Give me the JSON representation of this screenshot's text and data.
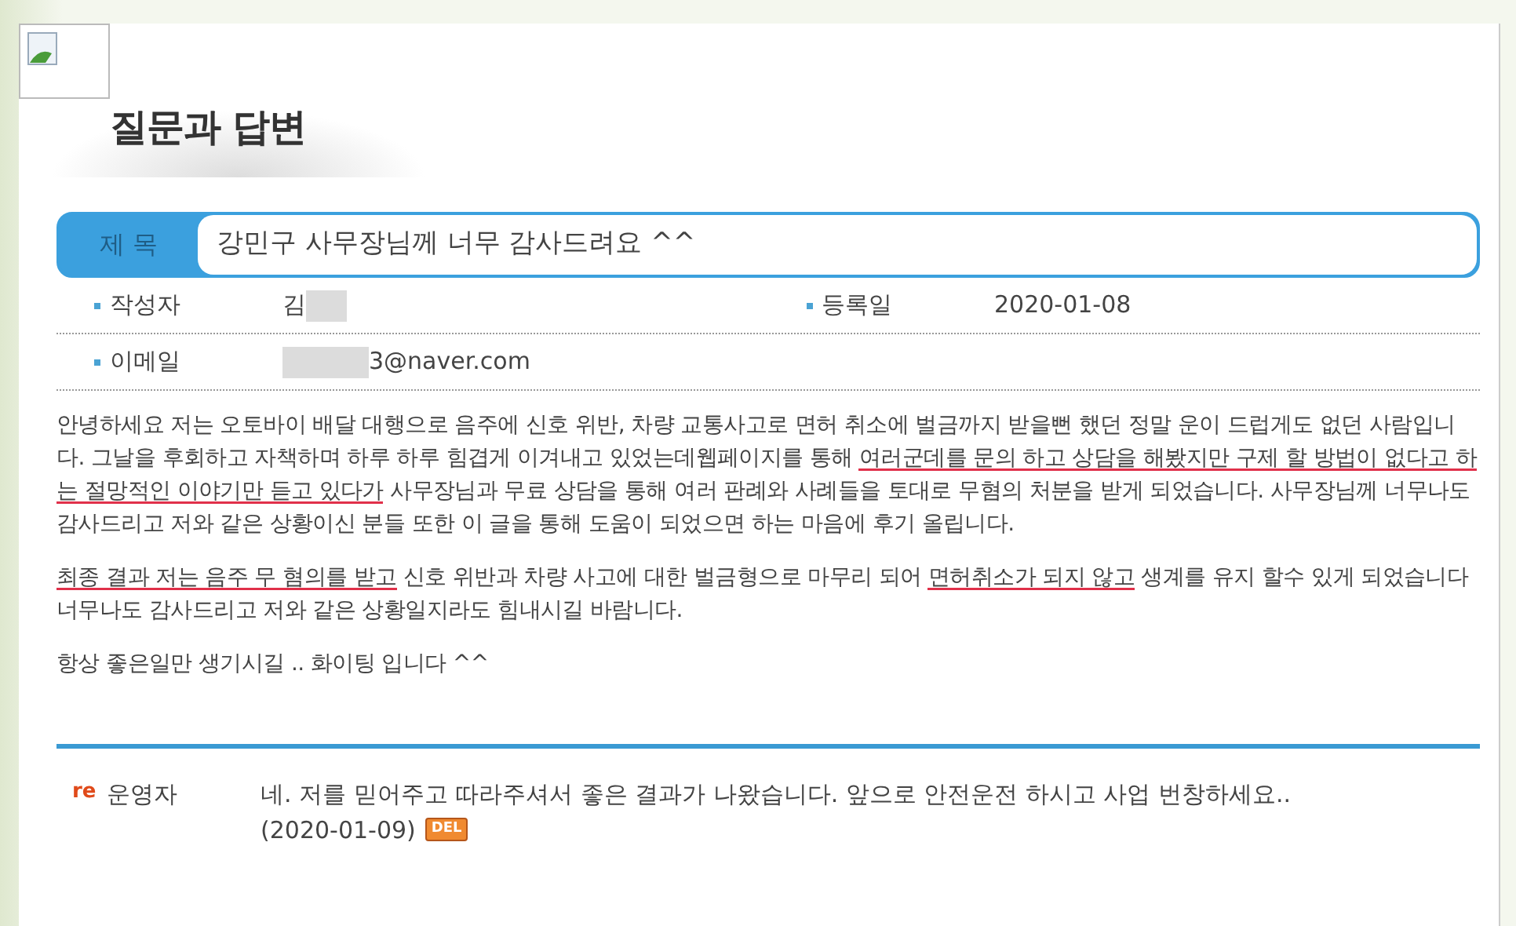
{
  "page_title": "질문과 답변",
  "subject": {
    "label": "제 목",
    "value": "강민구 사무장님께 너무 감사드려요 ^^"
  },
  "meta": [
    {
      "label": "작성자",
      "value": "김",
      "redacted": true
    },
    {
      "label": "등록일",
      "value": "2020-01-08"
    },
    {
      "label": "이메일",
      "value": "3@naver.com",
      "redacted": true
    }
  ],
  "body": [
    {
      "segments": [
        {
          "text": "안녕하세요 저는 오토바이  배달 대행으로 음주에 신호 위반, 차량 교통사고로 면허 취소에 벌금까지 받을뻔 했던 정말 운이 드럽게도 없던 사람입니다. 그날을 후회하고 자책하며 하루 하루 힘겹게 이겨내고 있었는데웹페이지를 통해 ",
          "underlined": false
        },
        {
          "text": "여러군데를 문의 하고 상담을 해봤지만 구제 할 방법이 없다고 하는 절망적인 이야기만 듣고 있다가",
          "underlined": true
        },
        {
          "text": " 사무장님과 무료 상담을 통해 여러 판례와 사례들을 토대로 무혐의 처분을 받게 되었습니다. 사무장님께 너무나도 감사드리고 저와 같은 상황이신 분들 또한 이 글을 통해 도움이 되었으면 하는 마음에 후기 올립니다.",
          "underlined": false
        }
      ]
    },
    {
      "segments": [
        {
          "text": "최종 결과 저는 음주 무 혐의를 받고",
          "underlined": true
        },
        {
          "text": " 신호 위반과 차량 사고에 대한 벌금형으로 마무리 되어 ",
          "underlined": false
        },
        {
          "text": "면허취소가 되지 않고",
          "underlined": true
        },
        {
          "text": " 생계를 유지  할수 있게 되었습니다 너무나도 감사드리고  저와 같은 상황일지라도 힘내시길 바람니다.",
          "underlined": false
        }
      ]
    },
    {
      "segments": [
        {
          "text": "항상 좋은일만 생기시길 .. 화이팅 입니다 ^^"
        }
      ]
    }
  ],
  "reply": {
    "badge": "re",
    "author": "운영자",
    "text": "네. 저를 믿어주고 따라주셔서 좋은 결과가 나왔습니다. 앞으로 안전운전 하시고 사업 번창하세요..",
    "date": "(2020-01-09)",
    "delete_label": "DEL"
  }
}
